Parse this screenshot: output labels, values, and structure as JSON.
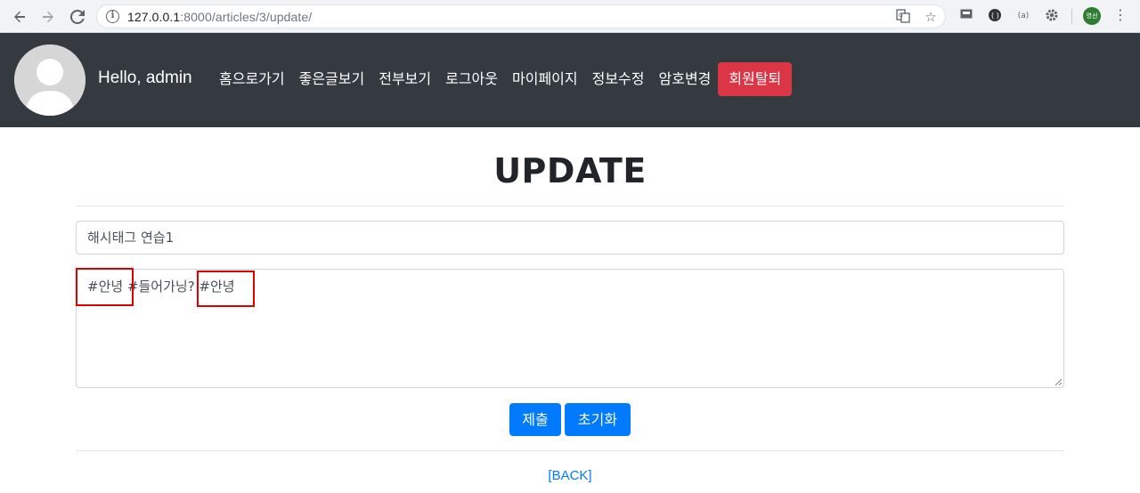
{
  "browser": {
    "url_host": "127.0.0.1",
    "url_rest": ":8000/articles/3/update/",
    "profile_label": "영선"
  },
  "navbar": {
    "greeting": "Hello, admin",
    "links": [
      "홈으로가기",
      "좋은글보기",
      "전부보기",
      "로그아웃",
      "마이페이지",
      "정보수정",
      "암호변경"
    ],
    "danger_label": "회원탈퇴"
  },
  "page": {
    "heading": "UPDATE",
    "title_value": "해시태그 연습1",
    "content_value": "#안녕 #들어가닝? #안녕",
    "submit_label": "제출",
    "reset_label": "초기화",
    "back_label": "[BACK]"
  },
  "colors": {
    "navbar_bg": "#343a40",
    "primary": "#007bff",
    "danger": "#dc3545",
    "annotation": "#e00000"
  }
}
